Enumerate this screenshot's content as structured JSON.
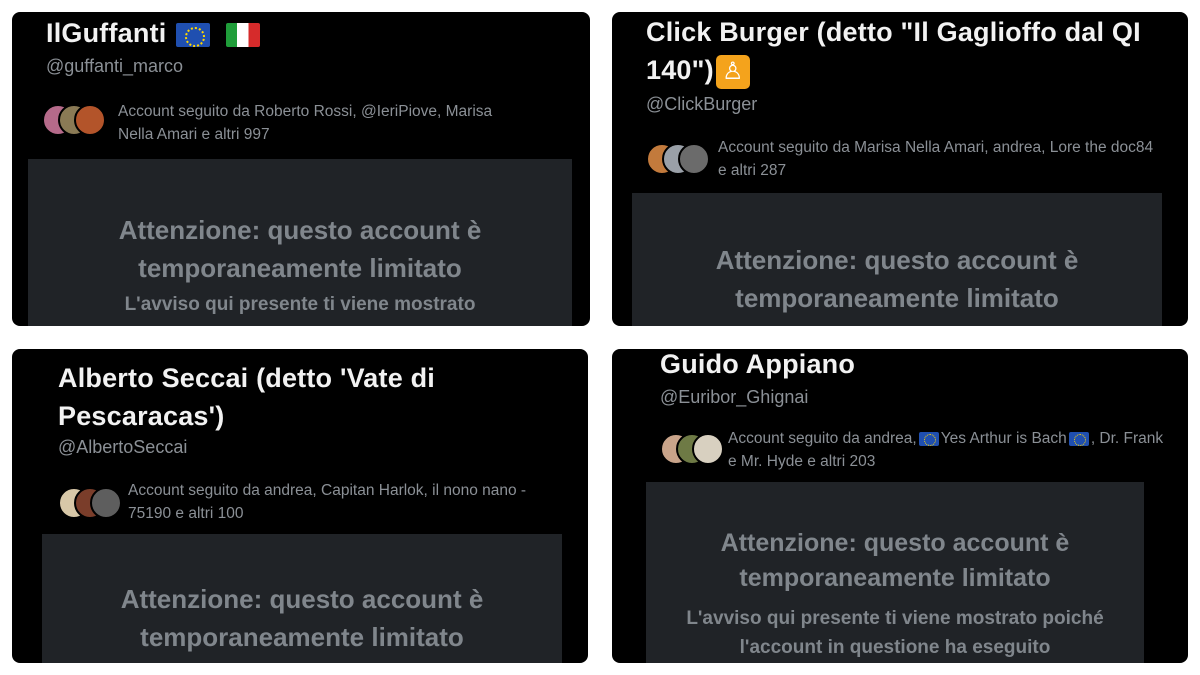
{
  "panels": [
    {
      "name": "IlGuffanti",
      "handle": "@guffanti_marco",
      "followers": "Account seguito da Roberto Rossi, @IeriPiove, Marisa Nella Amari e altri 997",
      "notice_title": "Attenzione: questo account è temporaneamente limitato",
      "notice_body": "L'avviso qui presente ti viene mostrato"
    },
    {
      "name": "Click Burger (detto \"Il Gaglioffo dal QI 140\")",
      "handle": "@ClickBurger",
      "followers": "Account seguito da Marisa Nella Amari, andrea, Lore the doc84 e altri 287",
      "notice_title": "Attenzione: questo account è temporaneamente limitato"
    },
    {
      "name": "Alberto Seccai (detto 'Vate di Pescaracas')",
      "handle": "@AlbertoSeccai",
      "followers": "Account seguito da andrea, Capitan Harlok, il nono nano - 75190 e altri 100",
      "notice_title": "Attenzione: questo account è temporaneamente limitato"
    },
    {
      "name": "Guido Appiano",
      "handle": "@Euribor_Ghignai",
      "followers_prefix": "Account seguito da andrea,",
      "followers_mid": "Yes Arthur is Bach",
      "followers_suffix": ", Dr. Frank e Mr. Hyde e altri 203",
      "notice_title": "Attenzione: questo account è temporaneamente limitato",
      "notice_body": "L'avviso qui presente ti viene mostrato poiché l'account in questione ha eseguito"
    }
  ],
  "icons": {
    "eu_flag": "eu-flag-icon",
    "italy_flag": "italy-flag-icon",
    "burger_emoji": "person-emoji-icon"
  },
  "colors": {
    "panel_bg": "#000000",
    "notice_bg": "#202327",
    "name_text": "#f2f2f2",
    "muted_text": "#8b9096",
    "notice_text": "#80868c",
    "eu_blue": "#1f4fb0",
    "emoji_orange": "#f4a31c"
  }
}
